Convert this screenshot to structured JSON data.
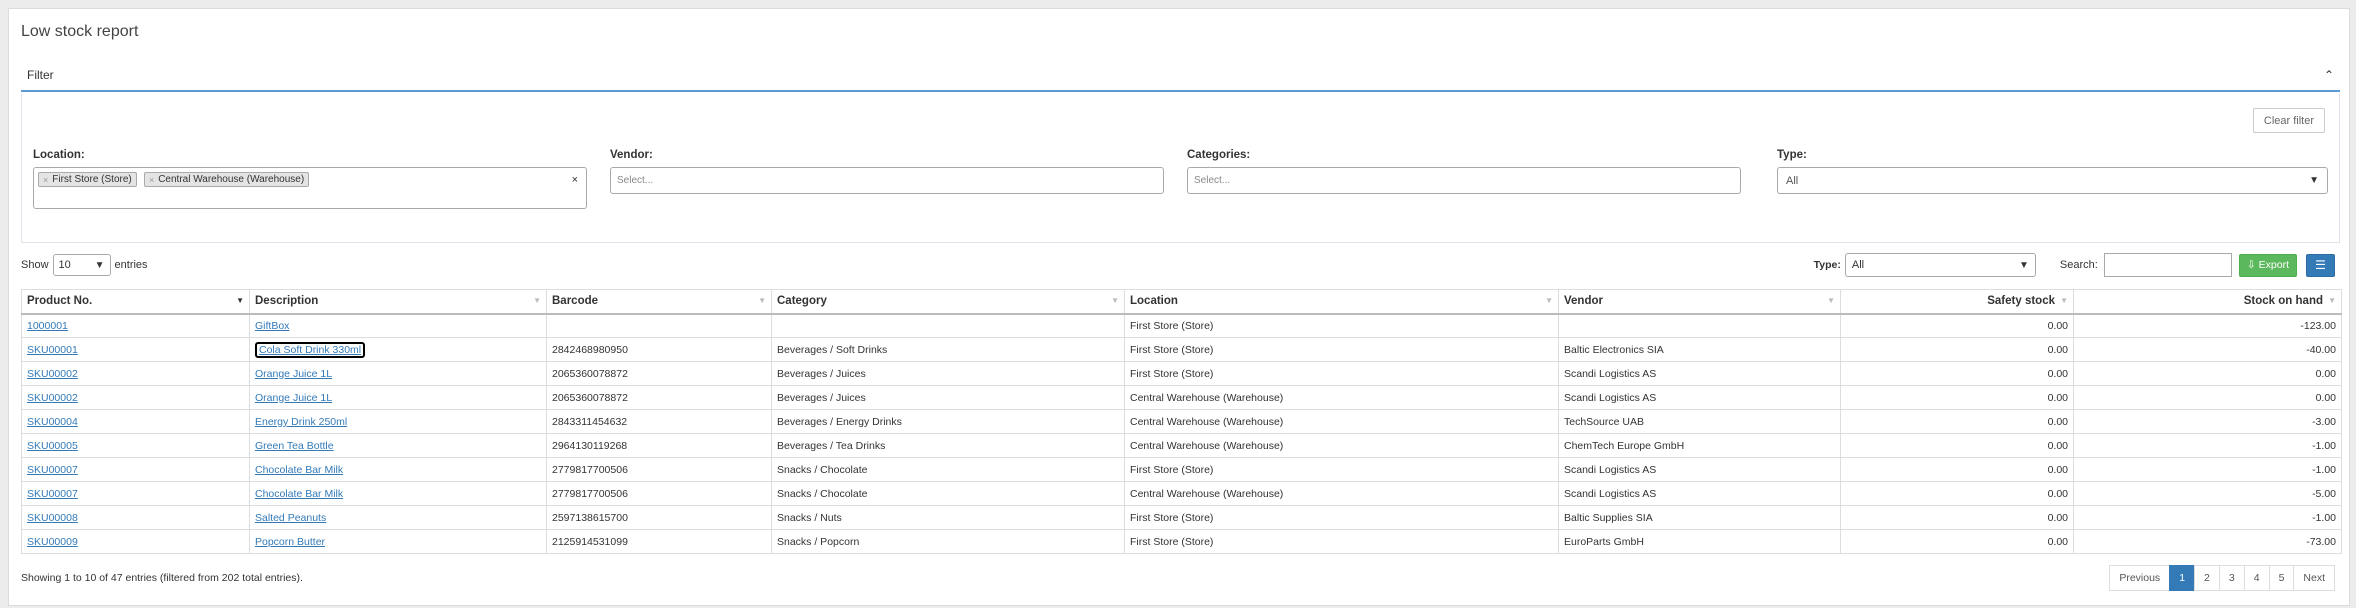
{
  "page": {
    "title": "Low stock report"
  },
  "filter": {
    "header": "Filter",
    "clear_label": "Clear filter",
    "location": {
      "label": "Location:",
      "chips": [
        "First Store (Store)",
        "Central Warehouse (Warehouse)"
      ]
    },
    "vendor": {
      "label": "Vendor:",
      "placeholder": "Select..."
    },
    "categories": {
      "label": "Categories:",
      "placeholder": "Select..."
    },
    "type": {
      "label": "Type:",
      "value": "All"
    }
  },
  "controls": {
    "show_label": "Show",
    "length_value": "10",
    "entries_label": "entries",
    "type_label": "Type:",
    "type_value": "All",
    "search_label": "Search:",
    "export_label": "Export"
  },
  "table": {
    "headers": [
      "Product No.",
      "Description",
      "Barcode",
      "Category",
      "Location",
      "Vendor",
      "Safety stock",
      "Stock on hand"
    ],
    "rows": [
      [
        "1000001",
        "GiftBox",
        "",
        "",
        "First Store (Store)",
        "",
        "0.00",
        "-123.00"
      ],
      [
        "SKU00001",
        "Cola Soft Drink 330ml",
        "2842468980950",
        "Beverages / Soft Drinks",
        "First Store (Store)",
        "Baltic Electronics SIA",
        "0.00",
        "-40.00"
      ],
      [
        "SKU00002",
        "Orange Juice 1L",
        "2065360078872",
        "Beverages / Juices",
        "First Store (Store)",
        "Scandi Logistics AS",
        "0.00",
        "0.00"
      ],
      [
        "SKU00002",
        "Orange Juice 1L",
        "2065360078872",
        "Beverages / Juices",
        "Central Warehouse (Warehouse)",
        "Scandi Logistics AS",
        "0.00",
        "0.00"
      ],
      [
        "SKU00004",
        "Energy Drink 250ml",
        "2843311454632",
        "Beverages / Energy Drinks",
        "Central Warehouse (Warehouse)",
        "TechSource UAB",
        "0.00",
        "-3.00"
      ],
      [
        "SKU00005",
        "Green Tea Bottle",
        "2964130119268",
        "Beverages / Tea Drinks",
        "Central Warehouse (Warehouse)",
        "ChemTech Europe GmbH",
        "0.00",
        "-1.00"
      ],
      [
        "SKU00007",
        "Chocolate Bar Milk",
        "2779817700506",
        "Snacks / Chocolate",
        "First Store (Store)",
        "Scandi Logistics AS",
        "0.00",
        "-1.00"
      ],
      [
        "SKU00007",
        "Chocolate Bar Milk",
        "2779817700506",
        "Snacks / Chocolate",
        "Central Warehouse (Warehouse)",
        "Scandi Logistics AS",
        "0.00",
        "-5.00"
      ],
      [
        "SKU00008",
        "Salted Peanuts",
        "2597138615700",
        "Snacks / Nuts",
        "First Store (Store)",
        "Baltic Supplies SIA",
        "0.00",
        "-1.00"
      ],
      [
        "SKU00009",
        "Popcorn Butter",
        "2125914531099",
        "Snacks / Popcorn",
        "First Store (Store)",
        "EuroParts GmbH",
        "0.00",
        "-73.00"
      ]
    ]
  },
  "footer": {
    "info": "Showing 1 to 10 of 47 entries (filtered from 202 total entries).",
    "pages": [
      "Previous",
      "1",
      "2",
      "3",
      "4",
      "5",
      "Next"
    ]
  }
}
